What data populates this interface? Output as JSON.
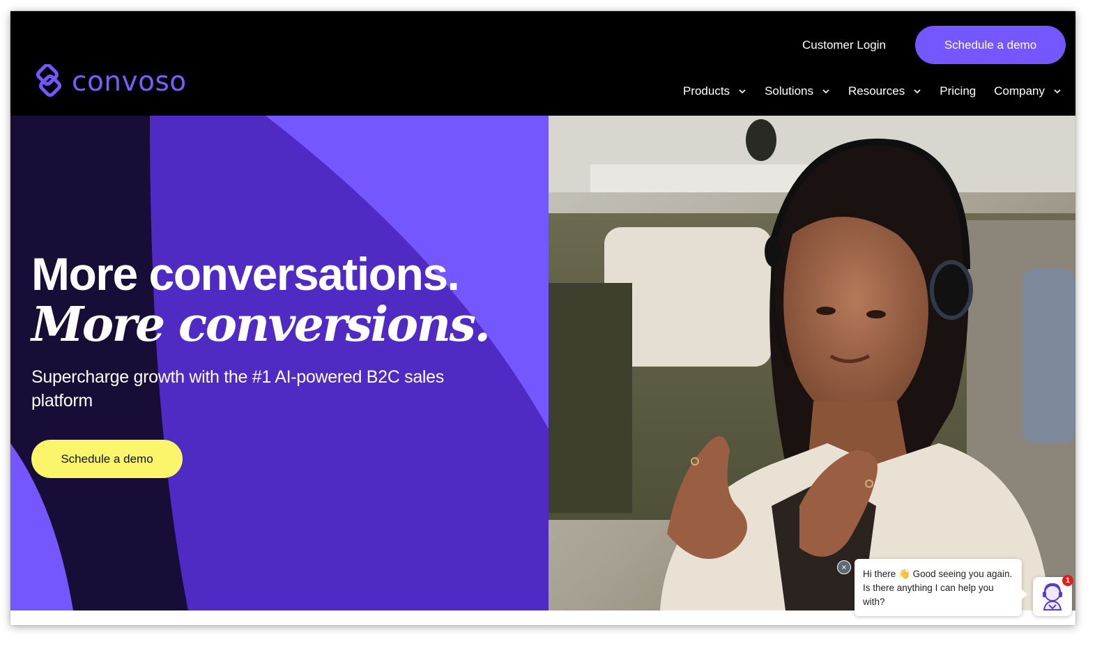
{
  "header": {
    "brand": "convoso",
    "customer_login": "Customer Login",
    "cta": "Schedule a demo",
    "nav": [
      "Products",
      "Solutions",
      "Resources",
      "Pricing",
      "Company"
    ]
  },
  "hero": {
    "headline_1": "More conversations.",
    "headline_2": "More conversions.",
    "subheadline": "Supercharge growth with the #1 AI-powered B2C sales platform",
    "cta": "Schedule a demo"
  },
  "chat": {
    "greeting_prefix": "Hi there",
    "wave_emoji": "👋",
    "greeting_rest": "Good seeing you again. Is there anything I can help you with?",
    "badge_count": "1",
    "close_symbol": "×"
  },
  "colors": {
    "header_bg": "#000000",
    "brand_purple": "#7457ff",
    "dark_violet": "#180d36",
    "mid_violet": "#4f2bc4",
    "hero_cta_yellow": "#fbf56c"
  }
}
